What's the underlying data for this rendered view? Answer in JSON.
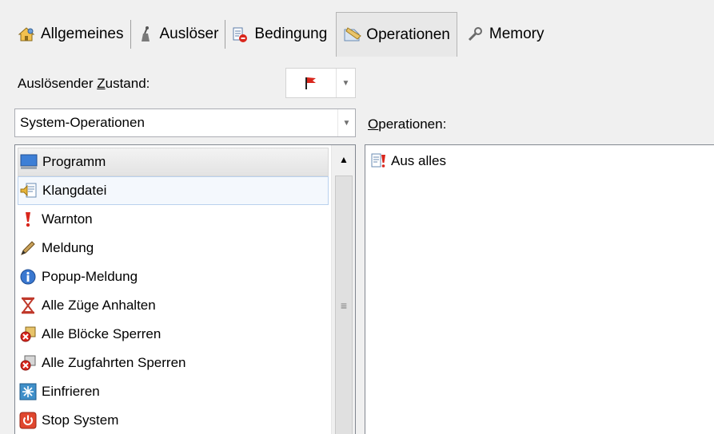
{
  "tabs": [
    {
      "label": "Allgemeines",
      "icon": "settings-house-icon",
      "active": false
    },
    {
      "label": "Auslöser",
      "icon": "trigger-icon",
      "active": false
    },
    {
      "label": "Bedingung",
      "icon": "condition-icon",
      "active": false
    },
    {
      "label": "Operationen",
      "icon": "operations-icon",
      "active": true
    },
    {
      "label": "Memory",
      "icon": "memory-icon",
      "active": false
    }
  ],
  "state": {
    "label_pre": "Auslösender ",
    "label_u": "Z",
    "label_post": "ustand:",
    "value_icon": "red-flag-icon"
  },
  "category": {
    "value": "System-Operationen"
  },
  "operations_label": {
    "u": "O",
    "rest": "perationen:"
  },
  "list_items": [
    {
      "label": "Programm",
      "icon": "monitor-icon"
    },
    {
      "label": "Klangdatei",
      "icon": "sound-file-icon"
    },
    {
      "label": "Warnton",
      "icon": "exclamation-icon"
    },
    {
      "label": "Meldung",
      "icon": "pencil-icon"
    },
    {
      "label": "Popup-Meldung",
      "icon": "info-icon"
    },
    {
      "label": "Alle Züge Anhalten",
      "icon": "hourglass-icon"
    },
    {
      "label": "Alle Blöcke Sperren",
      "icon": "block-lock-icon"
    },
    {
      "label": "Alle Zugfahrten Sperren",
      "icon": "route-lock-icon"
    },
    {
      "label": "Einfrieren",
      "icon": "snowflake-icon"
    },
    {
      "label": "Stop System",
      "icon": "power-icon"
    }
  ],
  "operations": [
    {
      "label": "Aus alles",
      "icon": "document-warning-icon"
    }
  ],
  "colors": {
    "accent_red": "#d9261c",
    "selection_border": "#b9d1ee"
  }
}
